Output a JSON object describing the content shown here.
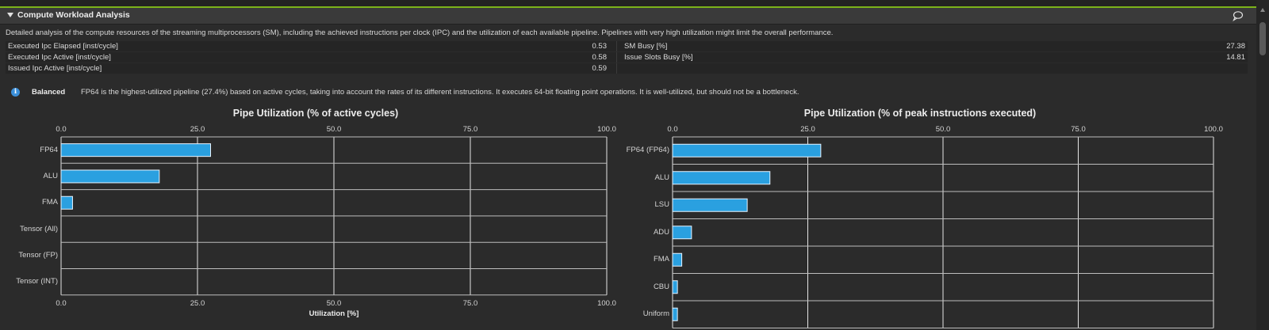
{
  "section": {
    "title": "Compute Workload Analysis",
    "description": "Detailed analysis of the compute resources of the streaming multiprocessors (SM), including the achieved instructions per clock (IPC) and the utilization of each available pipeline. Pipelines with very high utilization might limit the overall performance."
  },
  "metrics": [
    {
      "label": "Executed Ipc Elapsed [inst/cycle]",
      "value": "0.53",
      "label2": "SM Busy [%]",
      "value2": "27.38"
    },
    {
      "label": "Executed Ipc Active [inst/cycle]",
      "value": "0.58",
      "label2": "Issue Slots Busy [%]",
      "value2": "14.81"
    },
    {
      "label": "Issued Ipc Active [inst/cycle]",
      "value": "0.59",
      "label2": "",
      "value2": ""
    }
  ],
  "rule": {
    "title": "Balanced",
    "text": "FP64 is the highest-utilized pipeline (27.4%) based on active cycles, taking into account the rates of its different instructions. It executes 64-bit floating point operations. It is well-utilized, but should not be a bottleneck."
  },
  "colors": {
    "bar": "#2aa0e0",
    "accent_line": "#7cb31a",
    "info": "#3b8fd9"
  },
  "icons": {
    "collapse": "chevron-down-icon",
    "comment": "comment-icon",
    "info": "info-icon"
  },
  "chart_data": [
    {
      "type": "bar",
      "orientation": "horizontal",
      "title": "Pipe Utilization (% of active cycles)",
      "xlabel": "Utilization [%]",
      "ylabel": "",
      "xlim": [
        0,
        100
      ],
      "ticks": [
        "0.0",
        "25.0",
        "50.0",
        "75.0",
        "100.0"
      ],
      "ticks_bottom": true,
      "grid": true,
      "categories": [
        "FP64",
        "ALU",
        "FMA",
        "Tensor (All)",
        "Tensor (FP)",
        "Tensor (INT)"
      ],
      "values": [
        27.4,
        18.0,
        2.1,
        0,
        0,
        0
      ]
    },
    {
      "type": "bar",
      "orientation": "horizontal",
      "title": "Pipe Utilization (% of peak instructions executed)",
      "xlabel": "",
      "ylabel": "",
      "xlim": [
        0,
        100
      ],
      "ticks": [
        "0.0",
        "25.0",
        "50.0",
        "75.0",
        "100.0"
      ],
      "ticks_bottom": false,
      "grid": true,
      "categories": [
        "FP64 (FP64)",
        "ALU",
        "LSU",
        "ADU",
        "FMA",
        "CBU",
        "Uniform"
      ],
      "values": [
        27.4,
        18.0,
        13.8,
        3.5,
        1.7,
        0.9,
        0.9
      ]
    }
  ]
}
